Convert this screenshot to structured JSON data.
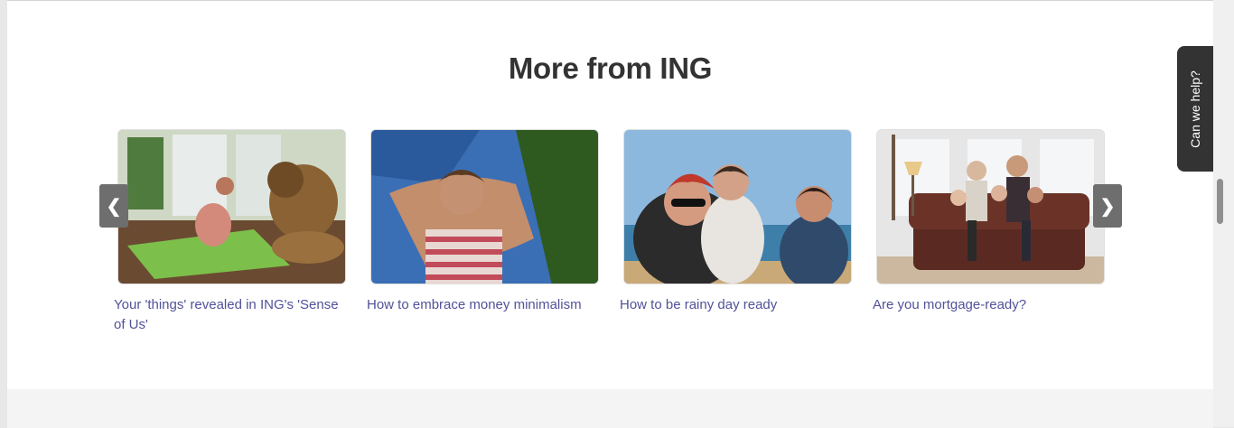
{
  "section": {
    "title": "More from ING"
  },
  "carousel": {
    "prev_icon": "chevron-left-icon",
    "next_icon": "chevron-right-icon",
    "cards": [
      {
        "title": "Your 'things' revealed in ING's 'Sense of Us'"
      },
      {
        "title": "How to embrace money minimalism"
      },
      {
        "title": "How to be rainy day ready"
      },
      {
        "title": "Are you mortgage-ready?"
      }
    ]
  },
  "help_tab": {
    "label": "Can we help?"
  },
  "colors": {
    "link": "#525199",
    "title": "#333333",
    "arrow": "#6e6e6e",
    "help_tab": "#333333"
  }
}
